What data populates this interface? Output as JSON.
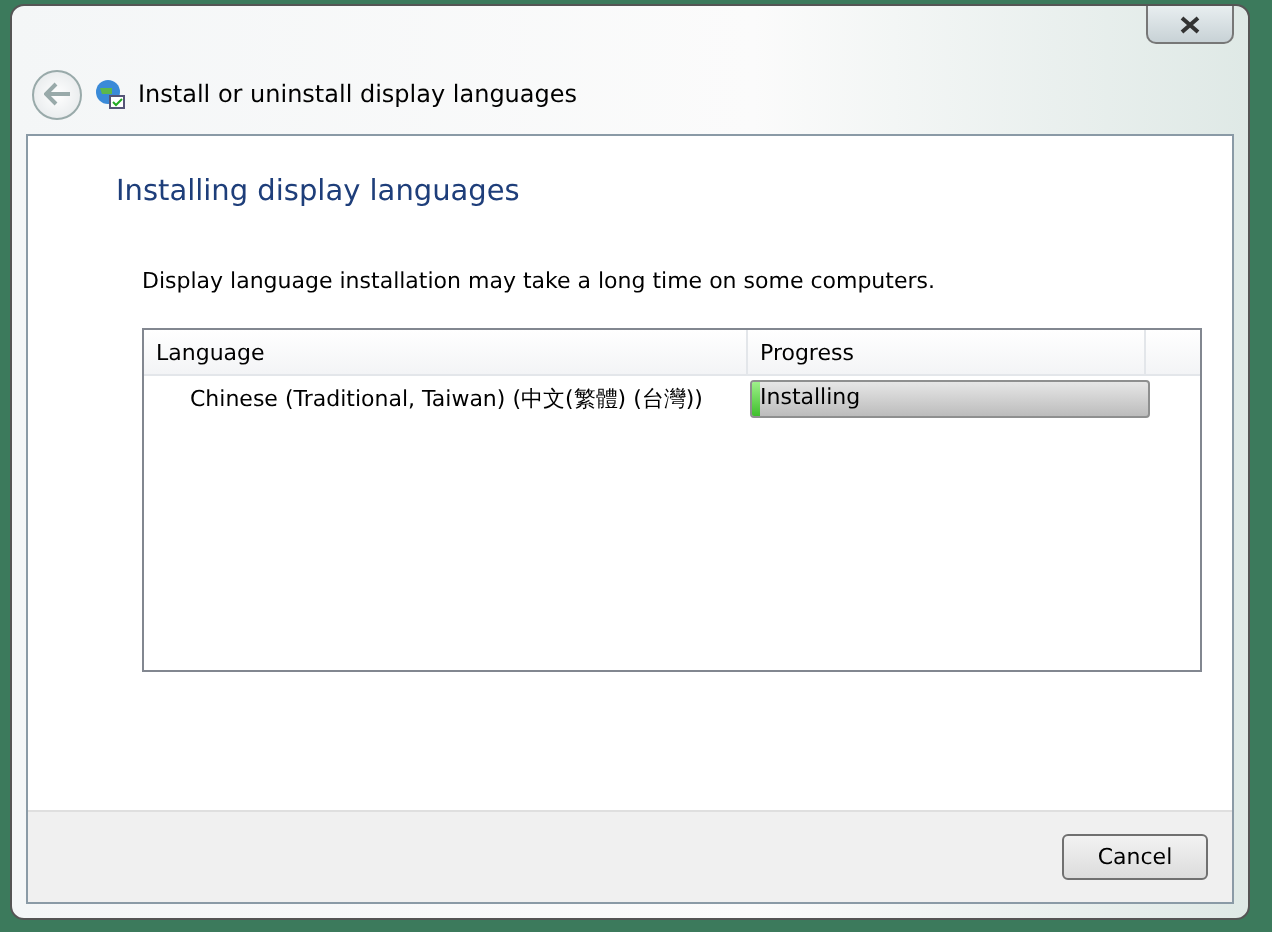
{
  "window": {
    "title": "Install or uninstall display languages"
  },
  "heading": "Installing display languages",
  "description": "Display language installation may take a long time on some computers.",
  "table": {
    "columns": [
      "Language",
      "Progress"
    ],
    "rows": [
      {
        "language": "Chinese (Traditional, Taiwan) (中文(繁體) (台灣))",
        "status": "Installing",
        "level": 0.02
      }
    ]
  },
  "buttons": [
    "Cancel"
  ]
}
